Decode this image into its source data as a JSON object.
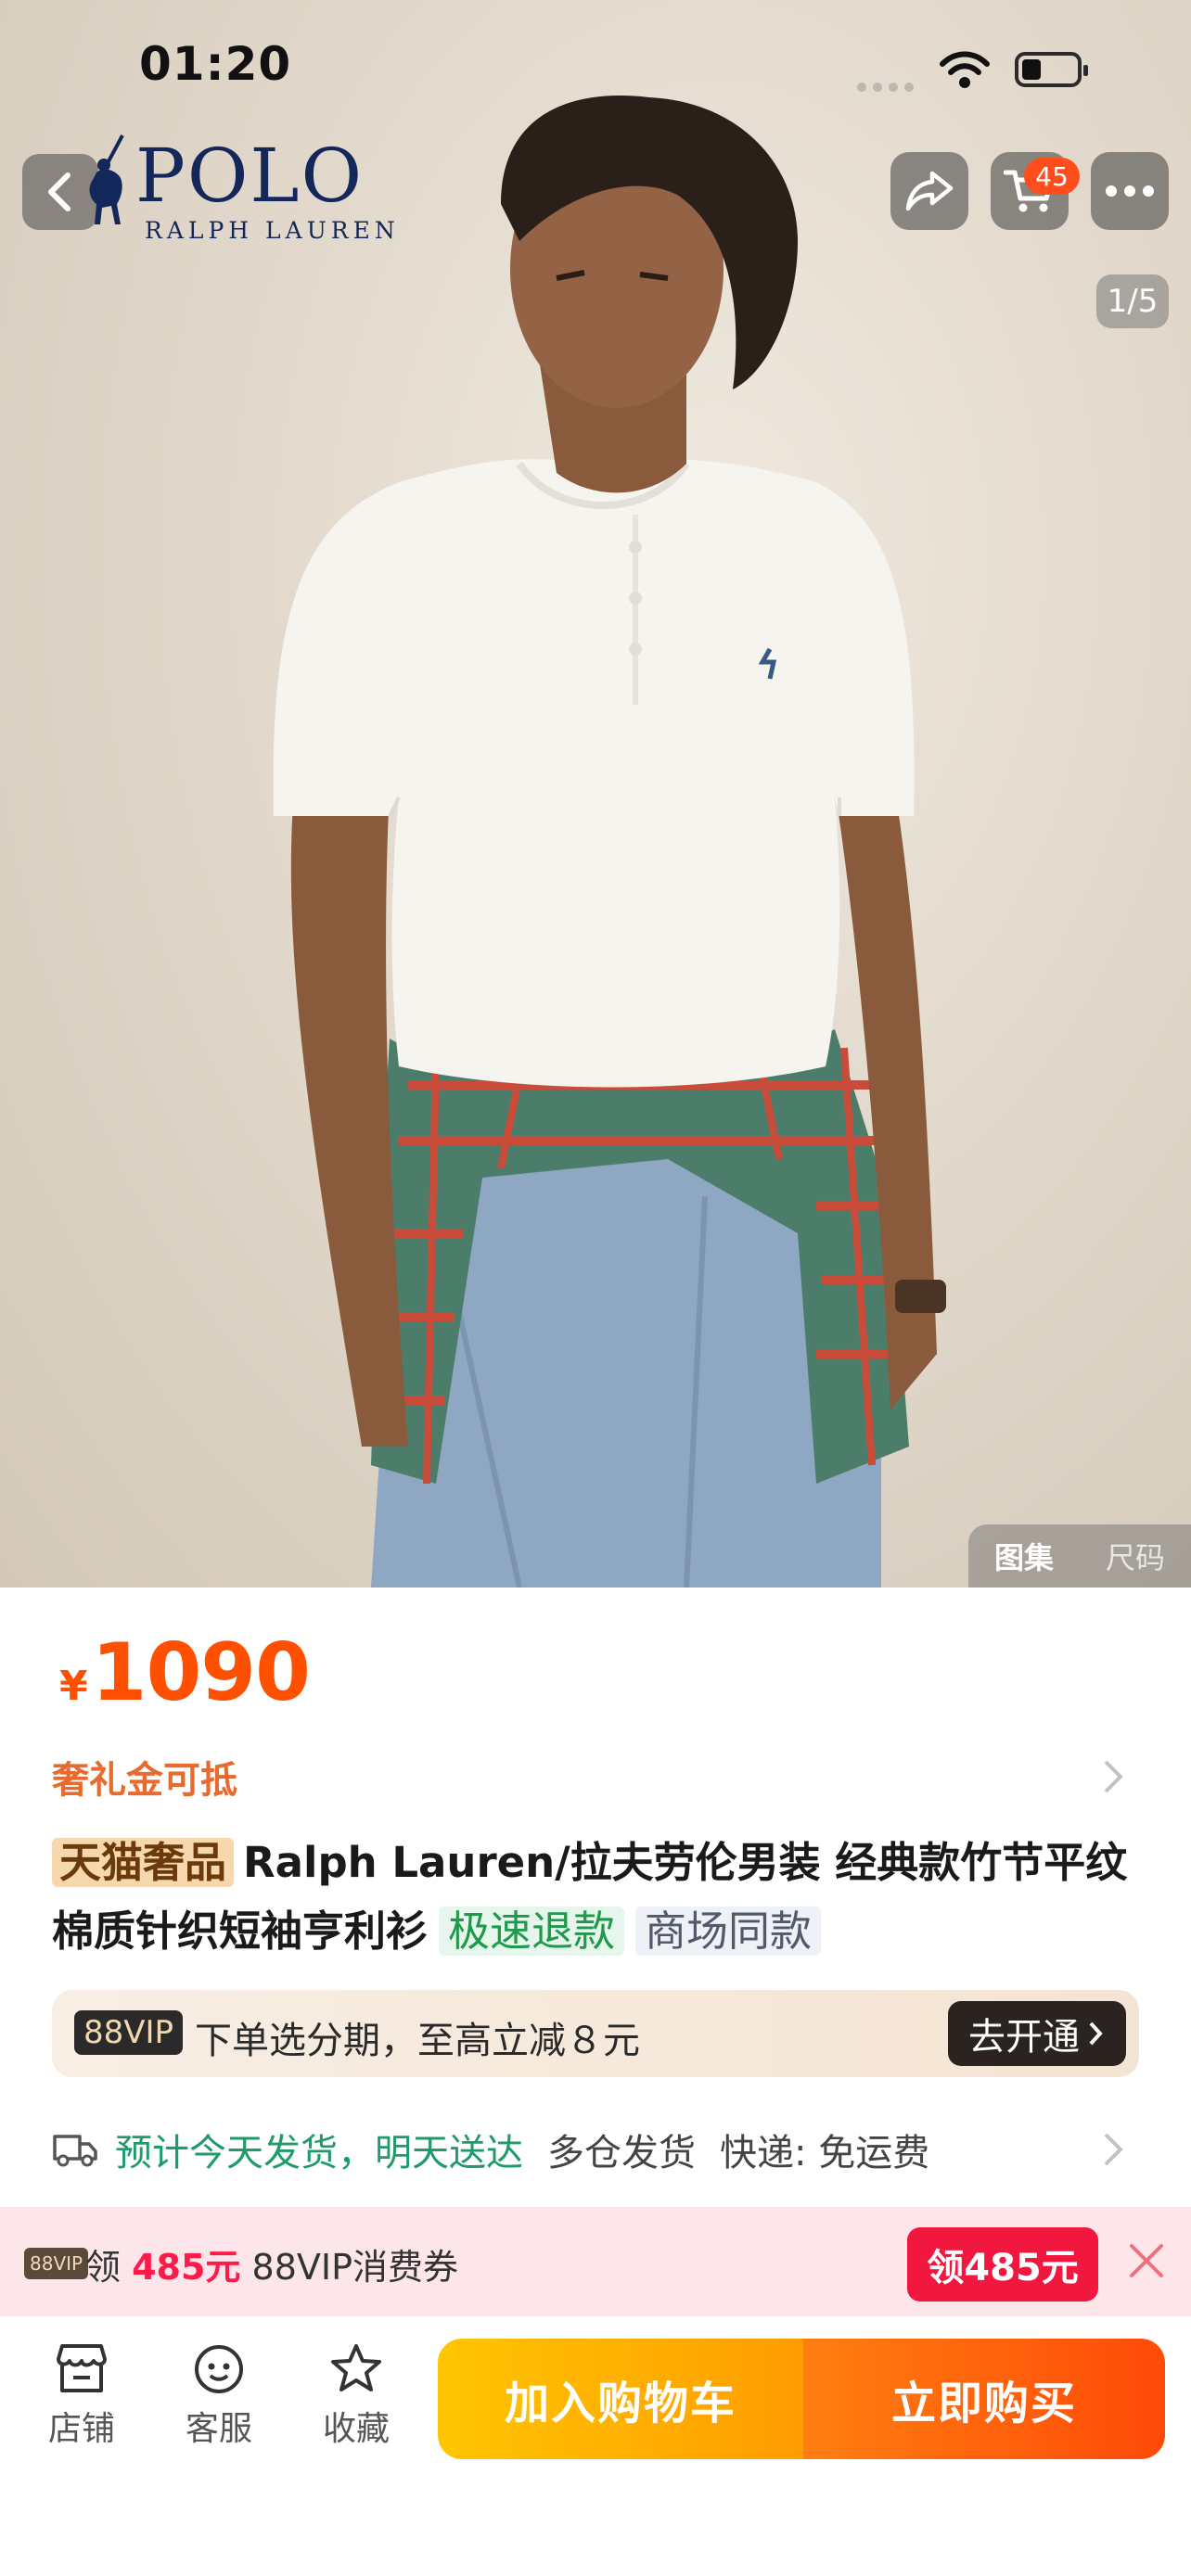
{
  "status_bar": {
    "time": "01:20"
  },
  "header": {
    "brand_title": "POLO",
    "brand_subtitle": "RALPH LAUREN",
    "cart_count": "45"
  },
  "gallery": {
    "pager": "1/5",
    "tabs": [
      {
        "label": "图集",
        "active": true
      },
      {
        "label": "尺码",
        "active": false
      }
    ]
  },
  "product": {
    "currency": "¥",
    "price": "1090",
    "subsidy_label": "奢礼金可抵",
    "mall_tag": "天猫奢品",
    "title": "Ralph Lauren/拉夫劳伦男装 经典款竹节平纹棉质针织短袖亨利衫",
    "tags": [
      "极速退款",
      "商场同款"
    ]
  },
  "vip": {
    "badge": "88VIP",
    "text": "下单选分期，至高立减８元",
    "button": "去开通"
  },
  "shipping": {
    "estimate": "预计今天发货，明天送达",
    "warehouse": "多仓发货",
    "express": "快递: 免运费"
  },
  "promo": {
    "badge": "88VIP",
    "prefix": "领",
    "amount": "485元",
    "suffix": "88VIP消费券",
    "button": "领485元"
  },
  "bottom_nav": {
    "items": [
      {
        "label": "店铺",
        "icon": "store-icon"
      },
      {
        "label": "客服",
        "icon": "service-icon"
      },
      {
        "label": "收藏",
        "icon": "star-icon"
      }
    ],
    "add_to_cart": "加入购物车",
    "buy_now": "立即购买"
  },
  "colors": {
    "price": "#ff5000",
    "cart_button": "#ffb300",
    "buy_button": "#ff5a0a",
    "promo_button": "#f2173f"
  }
}
